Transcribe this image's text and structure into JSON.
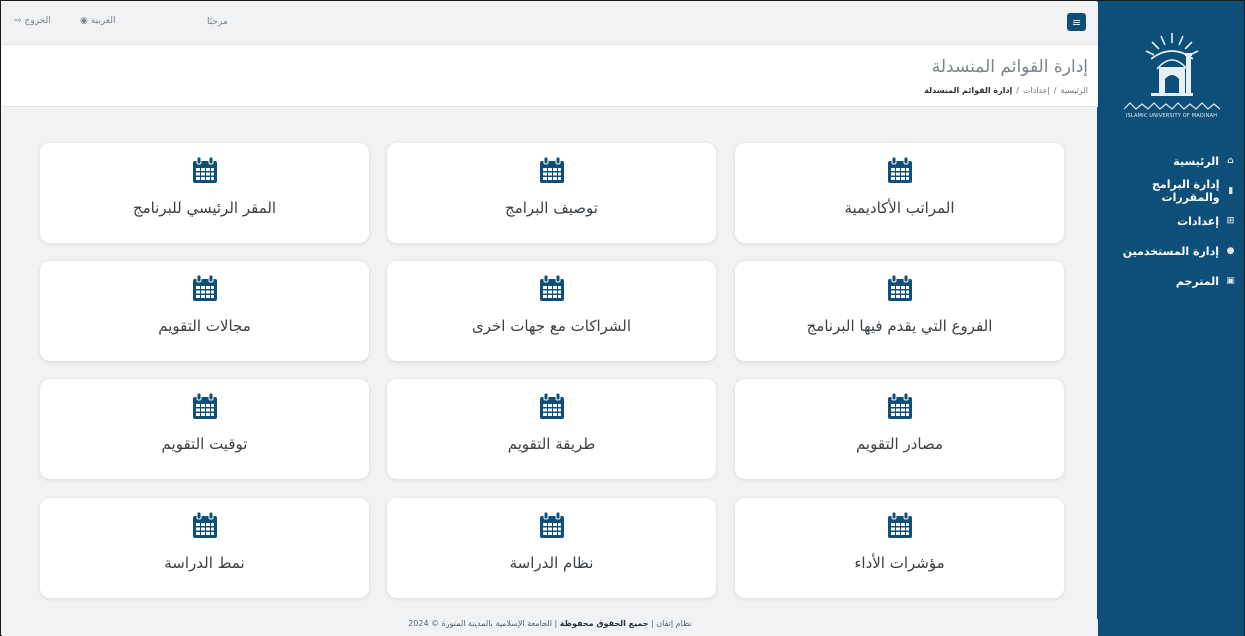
{
  "colors": {
    "sidebar": "#0d4f79",
    "icon": "#0d4f79",
    "background": "#f1f2f4"
  },
  "sidebar": {
    "logo_caption": "ISLAMIC UNIVERSITY OF MADINAH",
    "items": [
      {
        "label": "الرئيسية",
        "icon": "home-icon"
      },
      {
        "label": "إدارة البرامج والمقررات",
        "icon": "book-icon"
      },
      {
        "label": "إعدادات",
        "icon": "settings-icon"
      },
      {
        "label": "إدارة المستخدمين",
        "icon": "users-icon"
      },
      {
        "label": "المترجم",
        "icon": "translate-icon"
      }
    ]
  },
  "topbar": {
    "welcome": "مرحبًا",
    "language": "العربية",
    "logout": "الخروج"
  },
  "header": {
    "title": "إدارة القوائم المنسدلة",
    "breadcrumb": [
      "الرئيسية",
      "إعدادات",
      "إدارة القوائم المنسدلة"
    ]
  },
  "cards": [
    {
      "label": "المراتب الأكاديمية",
      "icon": "calendar-icon"
    },
    {
      "label": "توصيف البرامج",
      "icon": "calendar-icon"
    },
    {
      "label": "المقر الرئيسي للبرنامج",
      "icon": "calendar-icon"
    },
    {
      "label": "الفروع التي يقدم فيها البرنامج",
      "icon": "calendar-icon"
    },
    {
      "label": "الشراكات مع جهات اخرى",
      "icon": "calendar-icon"
    },
    {
      "label": "مجالات التقويم",
      "icon": "calendar-icon"
    },
    {
      "label": "مصادر التقويم",
      "icon": "calendar-icon"
    },
    {
      "label": "طريقة التقويم",
      "icon": "calendar-icon"
    },
    {
      "label": "توقيت التقويم",
      "icon": "calendar-icon"
    },
    {
      "label": "مؤشرات الأداء",
      "icon": "calendar-icon"
    },
    {
      "label": "نظام الدراسة",
      "icon": "calendar-icon"
    },
    {
      "label": "نمط الدراسة",
      "icon": "calendar-icon"
    }
  ],
  "footer": {
    "system": "نظام إتقان",
    "rights": "جميع الحقوق محفوظة",
    "owner": "الجامعة الإسلامية بالمدينة المنورة © 2024"
  }
}
